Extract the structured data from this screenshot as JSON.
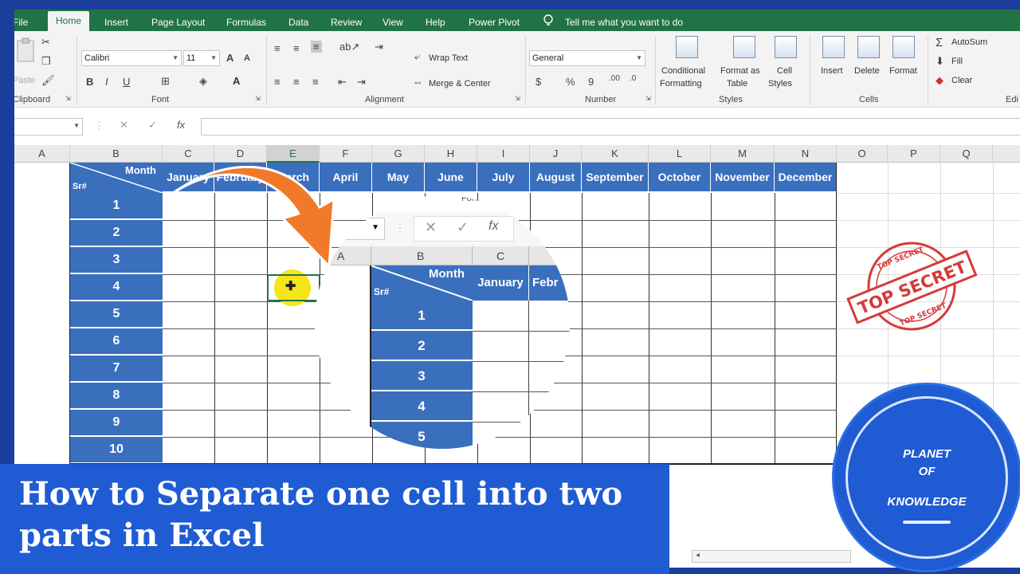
{
  "tabs": [
    "File",
    "Home",
    "Insert",
    "Page Layout",
    "Formulas",
    "Data",
    "Review",
    "View",
    "Help",
    "Power Pivot"
  ],
  "tell_me": "Tell me what you want to do",
  "ribbon": {
    "clipboard_label": "Clipboard",
    "paste_label": "Paste",
    "font_name": "Calibri",
    "font_size": "11",
    "font_label": "Font",
    "alignment_label": "Alignment",
    "wrap_text": "Wrap Text",
    "merge_center": "Merge & Center",
    "number_format": "General",
    "number_label": "Number",
    "conditional_formatting": [
      "Conditional",
      "Formatting"
    ],
    "format_as_table": [
      "Format as",
      "Table"
    ],
    "cell_styles": [
      "Cell",
      "Styles"
    ],
    "styles_label": "Styles",
    "insert": "Insert",
    "delete": "Delete",
    "format": "Format",
    "cells_label": "Cells",
    "autosum": "AutoSum",
    "fill": "Fill",
    "clear": "Clear",
    "editing_label": "Edi",
    "font_buttons": [
      "B",
      "I",
      "U"
    ],
    "font_grow": "A",
    "font_shrink": "A"
  },
  "formula_bar": {
    "name_box": "",
    "cancel": "✕",
    "enter": "✓",
    "fx": "fx"
  },
  "columns": [
    "A",
    "B",
    "C",
    "D",
    "E",
    "F",
    "G",
    "H",
    "I",
    "J",
    "K",
    "L",
    "M",
    "N",
    "O",
    "P",
    "Q"
  ],
  "table": {
    "corner_top": "Month",
    "corner_bottom": "Sr#",
    "months": [
      "January",
      "February",
      "March",
      "April",
      "May",
      "June",
      "July",
      "August",
      "September",
      "October",
      "November",
      "December"
    ],
    "rows": [
      "1",
      "2",
      "3",
      "4",
      "5",
      "6",
      "7",
      "8",
      "9",
      "10"
    ]
  },
  "zoom": {
    "font_fragment": "Font",
    "cols": [
      "A",
      "B",
      "C"
    ],
    "corner_top": "Month",
    "corner_bottom": "Sr#",
    "month1": "January",
    "month2": "Febr",
    "rows": [
      "1",
      "2",
      "3",
      "4",
      "5"
    ]
  },
  "caption": "How to Separate one cell into two parts in Excel",
  "logo": {
    "line1": "PLANET",
    "line2": "OF",
    "line3": "KNOWLEDGE"
  },
  "stamp": {
    "main": "TOP SECRET",
    "ring_top": "TOP SECRET",
    "ring_bottom": "TOP SECRET"
  },
  "colors": {
    "excel_green": "#217346",
    "table_blue": "#3a6fbe",
    "caption_blue": "#1f5bd2",
    "arrow_orange": "#f07a2a",
    "stamp_red": "#d63a3a"
  }
}
